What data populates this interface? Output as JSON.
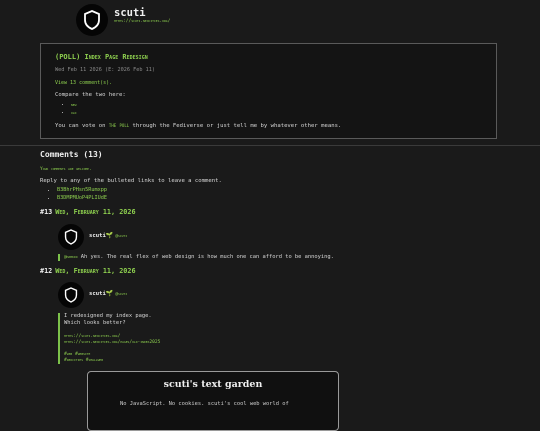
{
  "site": {
    "name": "scuti",
    "url": "https://scuti.neocities.org/"
  },
  "post": {
    "title": "(POLL) Index Page Redesign",
    "meta": "Wed Feb 11 2026 (E: 2026 Feb 11)",
    "comments_link": "View 13 comment(s).",
    "compare_text": "Compare the two here:",
    "options": [
      "new",
      "old"
    ],
    "vote_prefix": "You can vote on",
    "vote_link": "the poll",
    "vote_suffix": "through the Fediverse or just tell me by whatever other means."
  },
  "comments": {
    "heading": "Comments (13)",
    "welcome": "Your comments are welcome.",
    "instructions": "Reply to any of the bulleted links to leave a comment.",
    "links": [
      "B3BhrPHsn5Rumxpp",
      "B3DMPMUoP4PLIUdE"
    ]
  },
  "entries": [
    {
      "number": "#13",
      "date": "Wed, February 11, 2026",
      "author": "scuti",
      "handle": "@scuti",
      "mention": "@hamkin",
      "text": "Ah yes. The real flex of web design is how much one can afford to be annoying."
    },
    {
      "number": "#12",
      "date": "Wed, February 11, 2026",
      "author": "scuti",
      "handle": "@scuti",
      "line1": "I redesigned my index page.",
      "line2": "Which looks better?",
      "link1": "https://scuti.neocities.org/",
      "link2_a": "https://scuti.neocities.org/pages/old-index",
      "link2_b": "2025",
      "tags1": "#web #website",
      "tags2": "#neocities #smallweb"
    }
  ],
  "embed": {
    "title": "scuti's text garden",
    "description": "No JavaScript. No cookies. scuti's cool web world of"
  },
  "colors": {
    "accent": "#8fd14f",
    "background": "#1a1a1a",
    "text": "#d8d8d8"
  },
  "icons": {
    "logo": "shield-icon",
    "leaf": "leaf-icon"
  }
}
